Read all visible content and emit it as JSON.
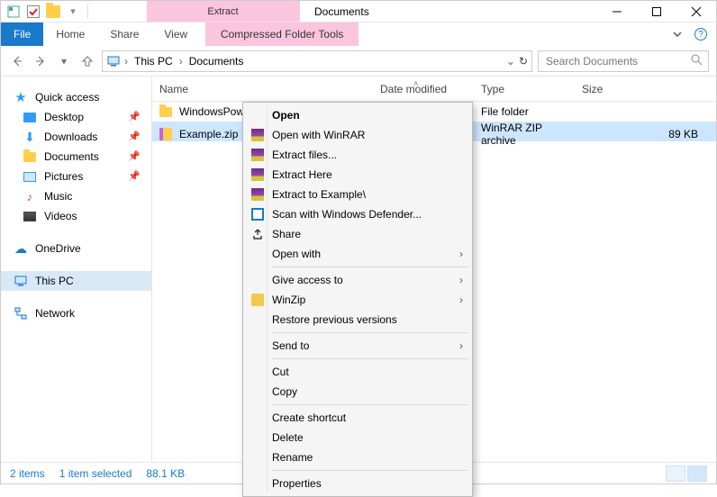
{
  "title": "Documents",
  "contextual_tab": {
    "top": "Extract",
    "bottom": "Compressed Folder Tools"
  },
  "ribbon_tabs": {
    "file": "File",
    "home": "Home",
    "share": "Share",
    "view": "View"
  },
  "address": {
    "seg1": "This PC",
    "seg2": "Documents"
  },
  "search": {
    "placeholder": "Search Documents"
  },
  "columns": {
    "name": "Name",
    "date": "Date modified",
    "type": "Type",
    "size": "Size"
  },
  "rows": [
    {
      "name": "WindowsPower",
      "type": "File folder",
      "size": ""
    },
    {
      "name": "Example.zip",
      "type": "WinRAR ZIP archive",
      "size": "89 KB"
    }
  ],
  "sidebar": {
    "quick_access": "Quick access",
    "items": [
      {
        "label": "Desktop"
      },
      {
        "label": "Downloads"
      },
      {
        "label": "Documents"
      },
      {
        "label": "Pictures"
      },
      {
        "label": "Music"
      },
      {
        "label": "Videos"
      }
    ],
    "onedrive": "OneDrive",
    "thispc": "This PC",
    "network": "Network"
  },
  "context_menu": {
    "open": "Open",
    "open_winrar": "Open with WinRAR",
    "extract_files": "Extract files...",
    "extract_here": "Extract Here",
    "extract_to": "Extract to Example\\",
    "defender": "Scan with Windows Defender...",
    "share": "Share",
    "open_with": "Open with",
    "give_access": "Give access to",
    "winzip": "WinZip",
    "restore": "Restore previous versions",
    "send_to": "Send to",
    "cut": "Cut",
    "copy": "Copy",
    "shortcut": "Create shortcut",
    "delete": "Delete",
    "rename": "Rename",
    "properties": "Properties"
  },
  "status": {
    "items": "2 items",
    "selected": "1 item selected",
    "sel_size": "88.1 KB"
  }
}
